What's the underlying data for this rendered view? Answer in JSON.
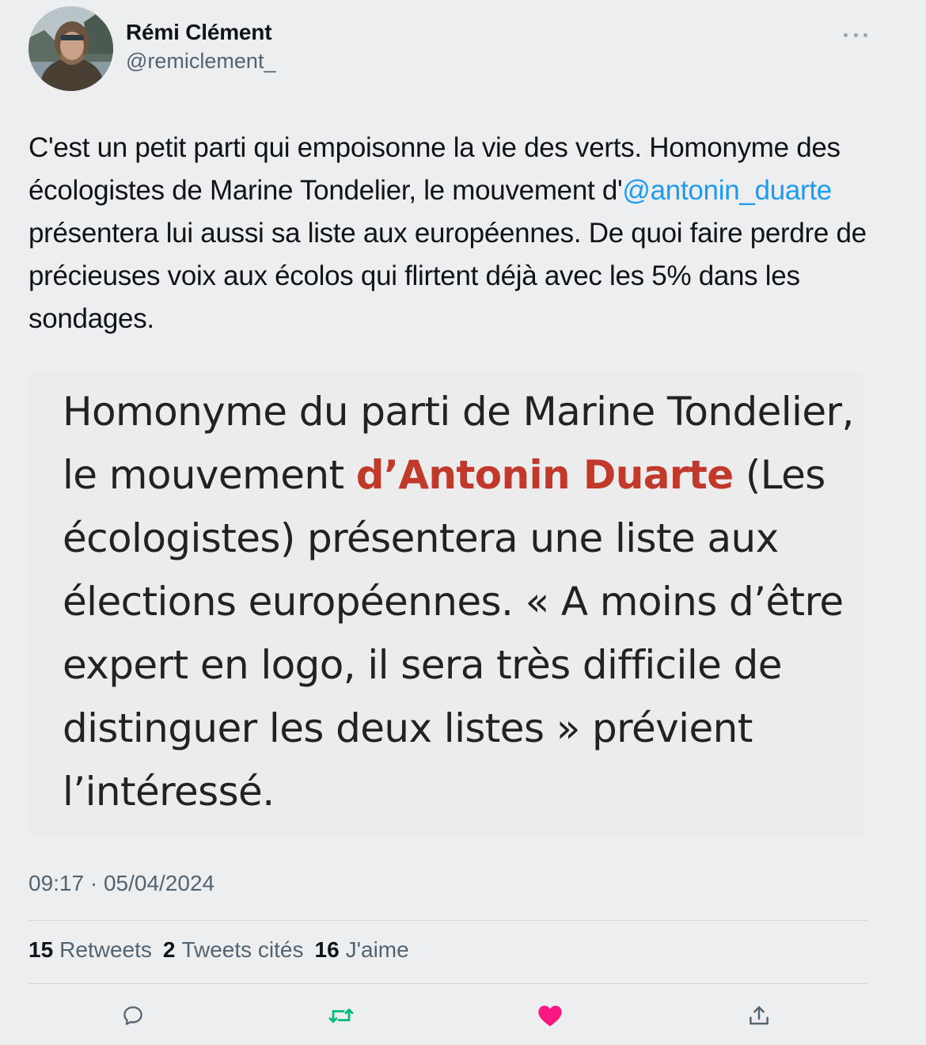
{
  "author": {
    "display_name": "Rémi Clément",
    "handle": "@remiclement_"
  },
  "tweet": {
    "text_part1": "C'est un petit parti qui empoisonne la vie des verts. Homonyme des écologistes de Marine Tondelier, le mouvement d'",
    "mention": "@antonin_duarte",
    "text_part2": " présentera lui aussi sa liste aux européennes. De quoi faire perdre de précieuses voix aux écolos qui flirtent déjà avec les 5% dans les sondages."
  },
  "media": {
    "text_part1": "Homonyme du parti de Marine Tondelier, le mouvement ",
    "highlight": "d’Antonin Duarte",
    "text_part2": " (Les écologistes) présentera une liste aux élections européennes. « A moins d’être expert en logo, il sera très difficile de distinguer les deux listes » prévient l’intéressé.",
    "highlight_color": "#c0392b"
  },
  "timestamp": "09:17 · 05/04/2024",
  "stats": {
    "retweets_count": "15",
    "retweets_label": "Retweets",
    "quotes_count": "2",
    "quotes_label": "Tweets cités",
    "likes_count": "16",
    "likes_label": "J'aime"
  },
  "actions": {
    "reply_icon": "reply-icon",
    "retweet_icon": "retweet-icon",
    "like_icon": "heart-icon",
    "share_icon": "share-icon",
    "retweet_color": "#00ba7c",
    "like_color": "#f91880"
  },
  "colors": {
    "mention": "#1d9bf0",
    "background": "#edeef0"
  }
}
